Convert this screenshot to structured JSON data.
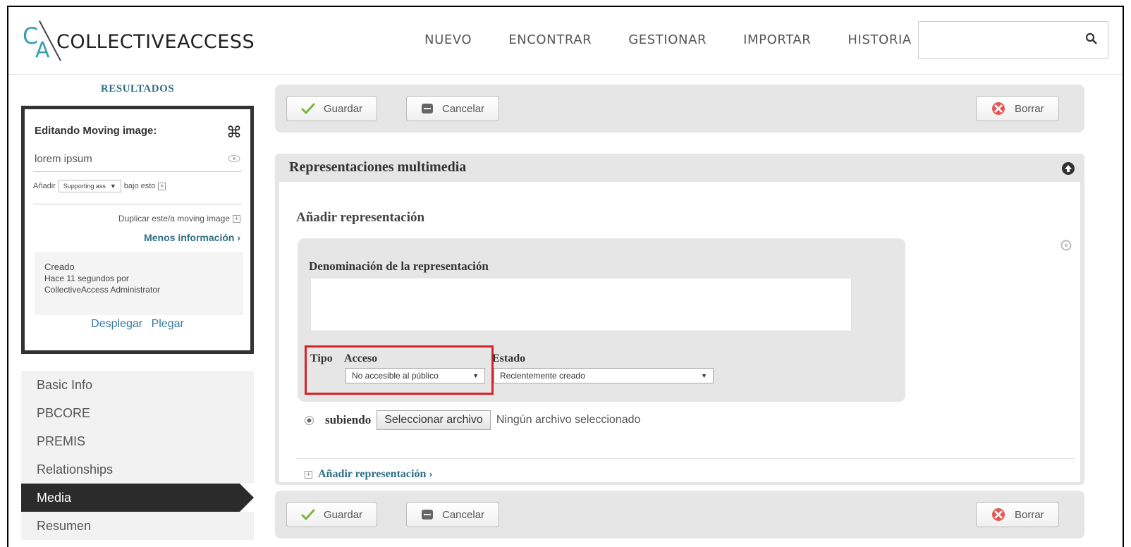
{
  "header": {
    "logo_text": "COLLECTIVEACCESS",
    "logo_c": "C",
    "logo_a": "A",
    "nav": [
      "NUEVO",
      "ENCONTRAR",
      "GESTIONAR",
      "IMPORTAR",
      "HISTORIA"
    ],
    "search_value": ""
  },
  "sidebar": {
    "results_title": "RESULTADOS",
    "edit_title": "Editando Moving image:",
    "cmd_glyph": "⌘",
    "item_name": "lorem ipsum",
    "add_label": "Añadir",
    "add_select": "Supporting ass",
    "add_suffix": "bajo esto",
    "duplicate_label": "Duplicar este/a moving image",
    "less_info": "Menos información ›",
    "created_label": "Creado",
    "created_when": "Hace 11 segundos por",
    "created_by": "CollectiveAccess Administrator",
    "expand": "Desplegar",
    "collapse": "Plegar",
    "menu": [
      "Basic Info",
      "PBCORE",
      "PREMIS",
      "Relationships",
      "Media",
      "Resumen"
    ],
    "active_menu": "Media"
  },
  "toolbar": {
    "save": "Guardar",
    "cancel": "Cancelar",
    "delete": "Borrar"
  },
  "panel": {
    "title": "Representaciones multimedia",
    "add_title": "Añadir representación",
    "name_label": "Denominación de la representación",
    "name_value": "",
    "tipo_label": "Tipo",
    "acceso_label": "Acceso",
    "acceso_value": "No accesible al público",
    "estado_label": "Estado",
    "estado_value": "Recientemente creado",
    "uploading_label": "subiendo",
    "file_button": "Seleccionar archivo",
    "no_file": "Ningún archivo seleccionado",
    "add_more": "Añadir representación ›"
  },
  "colors": {
    "accent": "#2f6f86",
    "highlight": "#d9232a",
    "active_menu_bg": "#2b2b2b"
  }
}
